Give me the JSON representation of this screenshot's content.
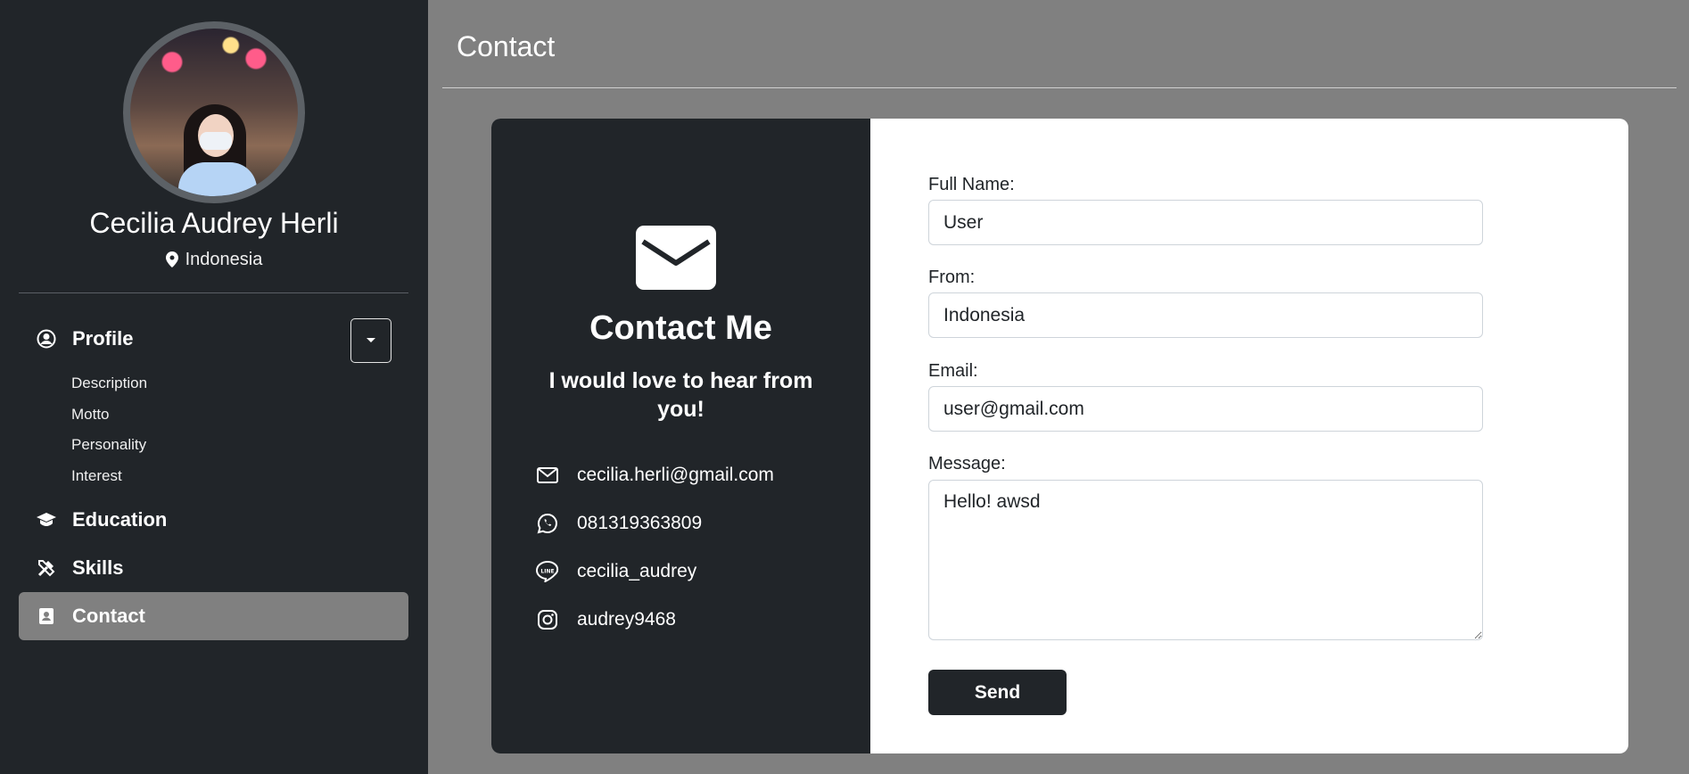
{
  "sidebar": {
    "name": "Cecilia Audrey Herli",
    "location": "Indonesia",
    "nav": {
      "profile": "Profile",
      "education": "Education",
      "skills": "Skills",
      "contact": "Contact"
    },
    "profile_subitems": [
      "Description",
      "Motto",
      "Personality",
      "Interest"
    ],
    "active_item": "Contact"
  },
  "main": {
    "title": "Contact"
  },
  "contact_card": {
    "heading": "Contact Me",
    "subheading": "I would love to hear from you!",
    "email": "cecilia.herli@gmail.com",
    "whatsapp": "081319363809",
    "line": "cecilia_audrey",
    "instagram": "audrey9468"
  },
  "form": {
    "full_name_label": "Full Name:",
    "full_name_value": "User",
    "from_label": "From:",
    "from_value": "Indonesia",
    "email_label": "Email:",
    "email_value": "user@gmail.com",
    "message_label": "Message:",
    "message_value": "Hello! awsd",
    "send_label": "Send"
  },
  "colors": {
    "sidebar_bg": "#212529",
    "page_bg": "#808080",
    "active_nav_bg": "#808080",
    "card_bg": "#ffffff",
    "button_bg": "#212529"
  },
  "icons": {
    "location": "map-pin-icon",
    "profile": "user-circle-icon",
    "education": "graduation-cap-icon",
    "skills": "tools-icon",
    "contact": "address-card-icon",
    "dropdown": "caret-down-icon",
    "mail": "envelope-icon",
    "whatsapp": "whatsapp-icon",
    "line": "line-icon",
    "instagram": "instagram-icon"
  }
}
